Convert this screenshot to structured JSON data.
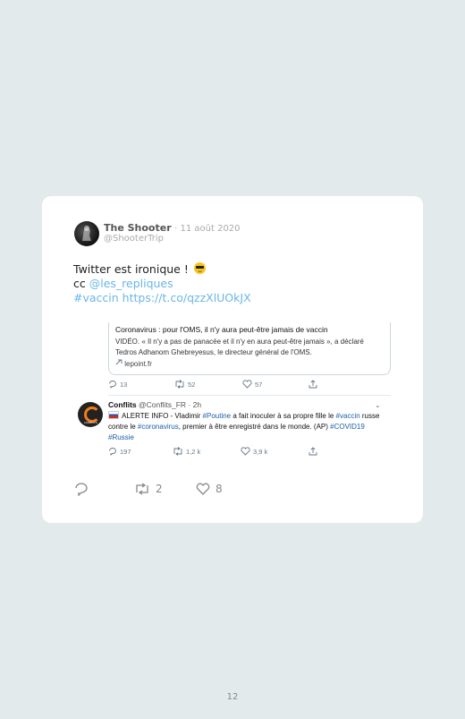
{
  "tweet": {
    "author_name": "The Shooter",
    "date": "· 11 août 2020",
    "handle": "@ShooterTrip",
    "text_line1": "Twitter est ironique !",
    "cc_prefix": "cc ",
    "mention": "@les_repliques",
    "hashtag": "#vaccin",
    "url": "https://t.co/qzzXlUOkJX",
    "reply_icon": "reply-icon",
    "retweet_count": "2",
    "like_count": "8"
  },
  "embedded": {
    "card_title": "Coronavirus : pour l'OMS, il n'y aura peut-être jamais de vaccin",
    "card_description": "VIDÉO. « Il n'y a pas de panacée et il n'y en aura peut-être jamais », a déclaré Tedros Adhanom Ghebreyesus, le directeur général de l'OMS.",
    "card_domain": "lepoint.fr",
    "replies": "13",
    "retweets": "52",
    "likes": "57",
    "rt_author": "Conflits",
    "rt_handle": "@Conflits_FR",
    "rt_time": "· 2h",
    "rt_avatar_label": "CONFLITS",
    "rt_text_1": "ALERTE INFO - Vladimir ",
    "rt_tag_1": "#Poutine",
    "rt_text_2": " a fait inoculer à sa propre fille le ",
    "rt_tag_2": "#vaccin",
    "rt_text_3": " russe contre le ",
    "rt_tag_3": "#coronavirus",
    "rt_text_4": ", premier à être enregistré dans le monde. (AP) ",
    "rt_tag_4": "#COVID19",
    "rt_tag_5": "#Russie",
    "rt_replies": "197",
    "rt_retweets": "1,2 k",
    "rt_likes": "3,9 k"
  },
  "page_number": "12",
  "colors": {
    "background": "#e3eaec",
    "link": "#6bb6e6",
    "hashtag": "#1b5fa8",
    "accent_orange": "#f07d1a"
  }
}
